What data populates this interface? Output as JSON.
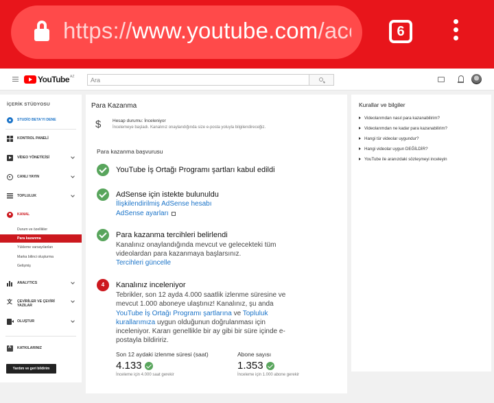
{
  "browser": {
    "url_scheme": "https://",
    "url_host": "www.youtube.com",
    "url_rest": "/account_monetization",
    "tab_count": "6"
  },
  "header": {
    "logo_text": "YouTube",
    "logo_region": "AZ",
    "search_placeholder": "Ara"
  },
  "sidebar": {
    "title": "İÇERİK STÜDYOSU",
    "items": [
      {
        "label": "STUDİO BETA'YI DENE"
      },
      {
        "label": "KONTROL PANELİ"
      },
      {
        "label": "VİDEO YÖNETİCİSİ"
      },
      {
        "label": "CANLI YAYIN"
      },
      {
        "label": "TOPLULUK"
      },
      {
        "label": "KANAL"
      },
      {
        "label": "ANALYTICS"
      },
      {
        "label": "ÇEVİRİLER VE ÇEVİRİ YAZILAR"
      },
      {
        "label": "OLUŞTUR"
      },
      {
        "label": "KATKILARINIZ"
      }
    ],
    "channel_sub": [
      "Durum ve özellikler",
      "Para kazanma",
      "Yükleme varsayılanları",
      "Marka bilinci oluşturma",
      "Gelişmiş"
    ],
    "help_button": "Yardım ve geri bildirim"
  },
  "main": {
    "title": "Para Kazanma",
    "account_status": "Hesap durumu: İnceleniyor",
    "account_note": "İncelemeye başladı. Kanalınız onaylandığında size e-posta yoluyla bilgilendireceğiz.",
    "section_title": "Para kazanma başvurusu",
    "step1_title": "YouTube İş Ortağı Programı şartları kabul edildi",
    "step2_title": "AdSense için istekte bulunuldu",
    "step2_link1": "İlişkilendirilmiş AdSense hesabı",
    "step2_link2": "AdSense ayarları",
    "step3_title": "Para kazanma tercihleri belirlendi",
    "step3_desc": "Kanalınız onaylandığında mevcut ve gelecekteki tüm videolardan para kazanmaya başlarsınız.",
    "step3_link": "Tercihleri güncelle",
    "step4_number": "4",
    "step4_title": "Kanalınız inceleniyor",
    "step4_desc_a": "Tebrikler, son 12 ayda 4.000 saatlik izlenme süresine ve mevcut 1.000 aboneye ulaştınız! Kanalınız, şu anda",
    "step4_link_a": "YouTube İş Ortağı Programı şartlarına",
    "step4_desc_b": "ve",
    "step4_link_b": "Topluluk kurallarımıza",
    "step4_desc_c": "uygun olduğunun doğrulanması için inceleniyor. Kararı genellikle bir ay gibi bir süre içinde e-postayla bildiririz.",
    "watch_label": "Son 12 aydaki izlenme süresi (saat)",
    "watch_value": "4.133",
    "watch_note": "İnceleme için 4.000 saat gerekir",
    "subs_label": "Abone sayısı",
    "subs_value": "1.353",
    "subs_note": "İnceleme için 1.000 abone gerekir"
  },
  "rules": {
    "title": "Kurallar ve bilgiler",
    "items": [
      "Videolarımdan nasıl para kazanabilirim?",
      "Videolarımdan ne kadar para kazanabilirim?",
      "Hangi tür videolar uygundur?",
      "Hangi videolar uygun DEĞİLDİR?",
      "YouTube ile aranızdaki sözleşmeyi inceleyin"
    ]
  }
}
